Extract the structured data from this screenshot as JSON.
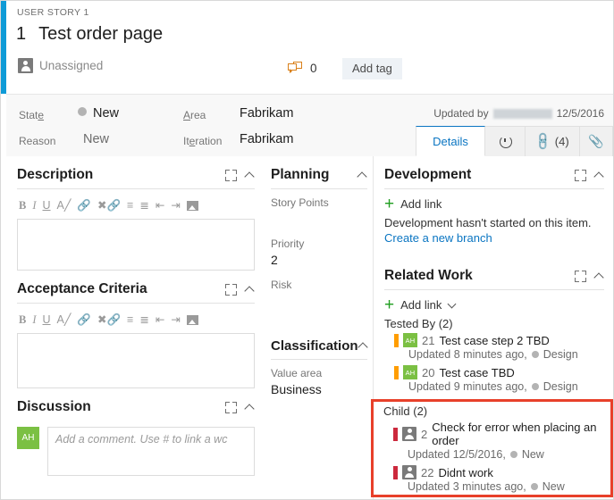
{
  "header": {
    "breadcrumb": "USER STORY 1",
    "work_item_id": "1",
    "title": "Test order page",
    "assigned_to": "Unassigned",
    "assigned_icon": "person-icon",
    "comment_count": "0",
    "comment_icon": "comment-bubbles-icon",
    "add_tag_label": "Add tag",
    "updated_by_label": "Updated by",
    "updated_by_name": "",
    "updated_date": "12/5/2016"
  },
  "fields": {
    "state_label": "State",
    "state_value": "New",
    "state_color": "#b3b3b3",
    "reason_label": "Reason",
    "reason_value": "New",
    "area_label": "Area",
    "area_value": "Fabrikam",
    "iteration_label": "Iteration",
    "iteration_value": "Fabrikam"
  },
  "tabs": [
    {
      "label": "Details",
      "icon": "",
      "active": true
    },
    {
      "label": "",
      "icon": "history-icon",
      "active": false
    },
    {
      "label": "(4)",
      "icon": "link-icon",
      "active": false
    },
    {
      "label": "",
      "icon": "paperclip-icon",
      "active": false
    }
  ],
  "description": {
    "title": "Description",
    "toolbar": [
      "B",
      "I",
      "U",
      "clear-format-icon",
      "insert-link-icon",
      "remove-link-icon",
      "bulleted-list-icon",
      "numbered-list-icon",
      "outdent-icon",
      "indent-icon",
      "insert-image-icon"
    ],
    "value": ""
  },
  "acceptance_criteria": {
    "title": "Acceptance Criteria",
    "value": ""
  },
  "discussion": {
    "title": "Discussion",
    "avatar_initials": "AH",
    "placeholder": "Add a comment. Use # to link a wc"
  },
  "planning": {
    "title": "Planning",
    "story_points_label": "Story Points",
    "story_points_value": "",
    "priority_label": "Priority",
    "priority_value": "2",
    "risk_label": "Risk",
    "risk_value": ""
  },
  "classification": {
    "title": "Classification",
    "value_area_label": "Value area",
    "value_area_value": "Business"
  },
  "development": {
    "title": "Development",
    "add_link_label": "Add link",
    "empty_text": "Development hasn't started on this item.",
    "create_branch_label": "Create a new branch"
  },
  "related_work": {
    "title": "Related Work",
    "add_link_label": "Add link",
    "groups": [
      {
        "name": "Tested By (2)",
        "items": [
          {
            "bar_color": "#ff9d00",
            "avatar_initials": "AH",
            "avatar_type": "initials",
            "id": "21",
            "title": "Test case step 2 TBD",
            "updated": "Updated 8 minutes ago,",
            "state": "Design",
            "state_color": "#b3b3b3"
          },
          {
            "bar_color": "#ff9d00",
            "avatar_initials": "AH",
            "avatar_type": "initials",
            "id": "20",
            "title": "Test case TBD",
            "updated": "Updated 9 minutes ago,",
            "state": "Design",
            "state_color": "#b3b3b3"
          }
        ]
      }
    ]
  },
  "child_group": {
    "name": "Child (2)",
    "highlight_color": "#e8402a",
    "items": [
      {
        "bar_color": "#cc293d",
        "avatar_type": "person",
        "id": "2",
        "title": "Check for error when placing an order",
        "updated": "Updated 12/5/2016,",
        "state": "New",
        "state_color": "#b3b3b3"
      },
      {
        "bar_color": "#cc293d",
        "avatar_type": "person",
        "id": "22",
        "title": "Didnt work",
        "updated": "Updated 3 minutes ago,",
        "state": "New",
        "state_color": "#b3b3b3"
      }
    ]
  },
  "theme": {
    "accent_blue": "#0f9bd7",
    "link_blue": "#0a75c2",
    "green": "#7bc043",
    "orange": "#ff9d00",
    "red": "#cc293d"
  }
}
